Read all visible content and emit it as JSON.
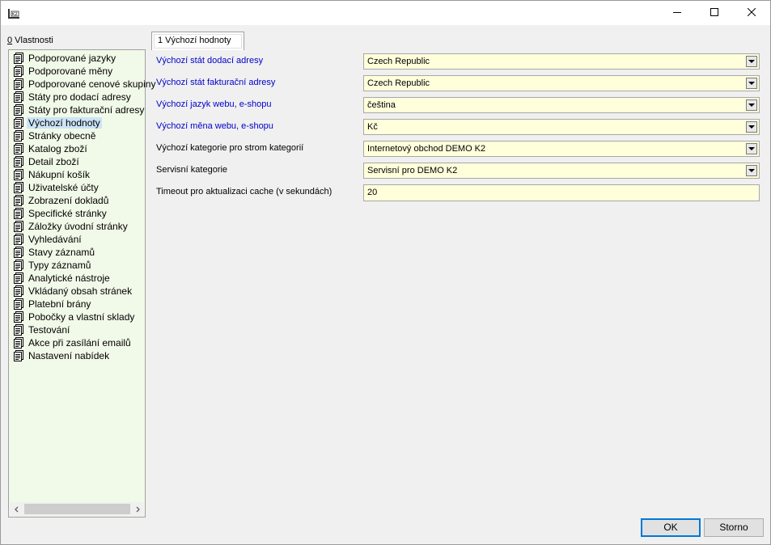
{
  "window": {
    "app_icon": "k2-app-icon",
    "controls": {
      "minimize": "minimize-icon",
      "maximize": "maximize-icon",
      "close": "close-icon"
    }
  },
  "panel": {
    "accel": "0",
    "label": " Vlastnosti"
  },
  "tree": {
    "items": [
      "Podporované jazyky",
      "Podporované měny",
      "Podporované cenové skupiny",
      "Státy pro dodací adresy",
      "Státy pro fakturační adresy",
      "Výchozí hodnoty",
      "Stránky obecně",
      "Katalog zboží",
      "Detail zboží",
      "Nákupní košík",
      "Uživatelské účty",
      "Zobrazení dokladů",
      "Specifické stránky",
      "Záložky úvodní stránky",
      "Vyhledávání",
      "Stavy záznamů",
      "Typy záznamů",
      "Analytické nástroje",
      "Vkládaný obsah stránek",
      "Platební brány",
      "Pobočky a vlastní sklady",
      "Testování",
      "Akce při zasílání emailů",
      "Nastavení nabídek"
    ],
    "selected_index": 5
  },
  "tabs": [
    {
      "label": "1 Výchozí hodnoty"
    }
  ],
  "form": {
    "fields": [
      {
        "label": "Výchozí stát dodací adresy",
        "value": "Czech Republic"
      },
      {
        "label": "Výchozí stát fakturační adresy",
        "value": "Czech Republic"
      },
      {
        "label": "Výchozí jazyk webu, e-shopu",
        "value": "čeština"
      },
      {
        "label": "Výchozí měna webu, e-shopu",
        "value": "Kč"
      },
      {
        "label": "Výchozí kategorie pro strom kategorií",
        "value": "Internetový obchod DEMO K2"
      },
      {
        "label": "Servisní kategorie",
        "value": "Servisní pro DEMO K2"
      },
      {
        "label": "Timeout pro aktualizaci cache (v sekundách)",
        "value": "20"
      }
    ]
  },
  "buttons": {
    "ok": "OK",
    "cancel": "Storno"
  },
  "colors": {
    "field_bg": "#ffffdc",
    "tree_bg": "#f1f9e8",
    "required_label": "#0000cc",
    "selection": "#cce4f7"
  }
}
